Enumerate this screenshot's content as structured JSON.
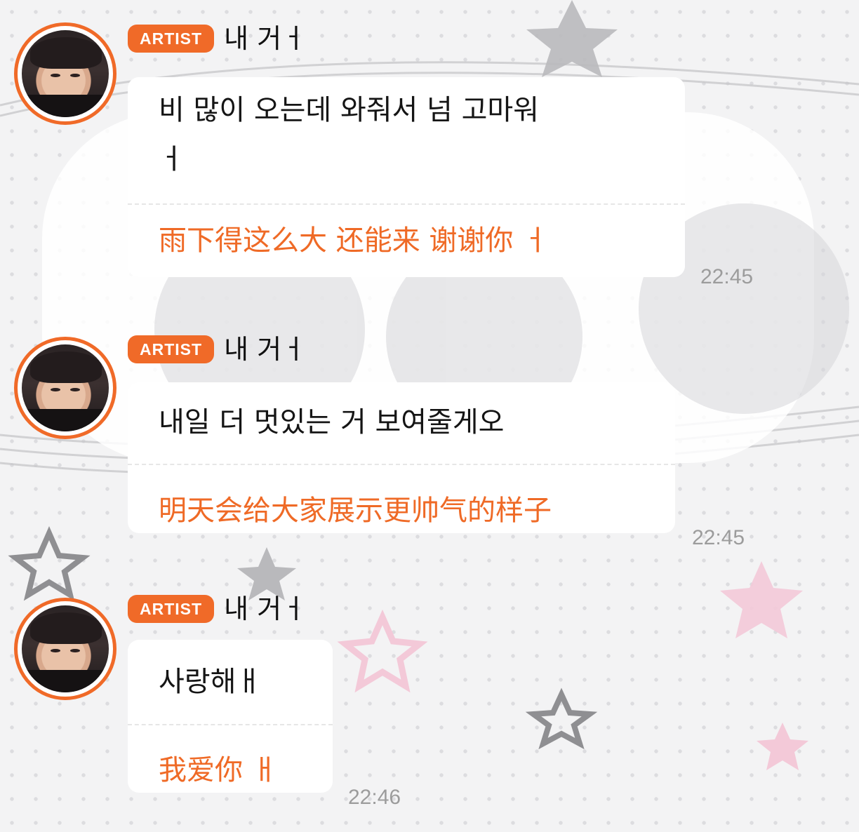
{
  "colors": {
    "accent": "#f06a28",
    "translation": "#ef6a26",
    "timestamp": "#9c9c9c",
    "bubble": "#ffffff"
  },
  "messages": [
    {
      "badge": "ARTIST",
      "name": "내 거ㅓ",
      "korean_lines": [
        "비 많이 오는데 와줘서 넘 고마워",
        "ㅓ"
      ],
      "chinese": "雨下得这么大 还能来 谢谢你 ㅓ",
      "time": "22:45"
    },
    {
      "badge": "ARTIST",
      "name": "내 거ㅓ",
      "korean_lines": [
        "내일 더 멋있는 거 보여줄게오"
      ],
      "chinese": "明天会给大家展示更帅气的样子",
      "time": "22:45"
    },
    {
      "badge": "ARTIST",
      "name": "내 거ㅓ",
      "korean_lines": [
        "사랑해ㅐ"
      ],
      "chinese": "我爱你 ㅐ",
      "time": "22:46"
    }
  ]
}
